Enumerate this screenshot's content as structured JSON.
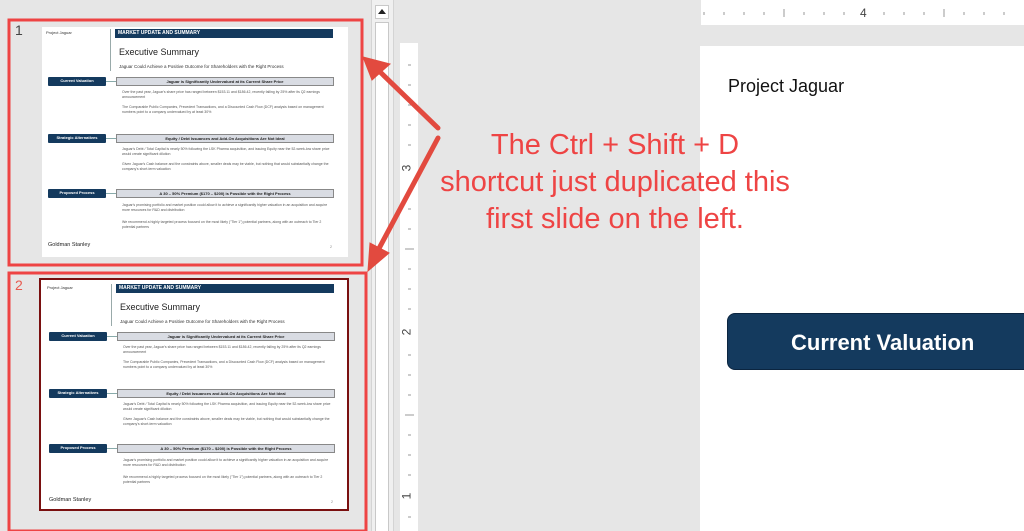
{
  "slides": [
    {
      "number": "1",
      "project": "Project Jaguar",
      "header": "MARKET UPDATE AND SUMMARY",
      "title": "Executive Summary",
      "subtitle": "Jaguar Could Achieve a Positive Outcome for Shareholders with the Right Process",
      "sections": [
        {
          "label": "Current Valuation",
          "box": "Jaguar is Significantly Undervalued at its Current Share Price",
          "bullets": [
            "Over the past year, Jaguar's share price has ranged between $153.11 and $186.42, recently falling by 25% after its Q2 earnings announcement",
            "The Comparable Public Companies, Precedent Transactions, and a Discounted Cash Flow (DCF) analysis based on management numbers point to a company undervalued by at least 30%"
          ]
        },
        {
          "label": "Strategic Alternatives",
          "box": "Equity / Debt Issuances and Add-On Acquisitions Are Not Ideal",
          "bullets": [
            "Jaguar's Debt / Total Capital is nearly 50% following the LSK Pharma acquisition, and issuing Equity near the 52-week-low share price would create significant dilution",
            "Given Jaguar's Cash balance and the constraints above, smaller deals may be viable, but nothing that would substantially change the company's short-term valuation"
          ]
        },
        {
          "label": "Proposed Process",
          "box": "A 30 – 50% Premium ($170 – $200) is Possible with the Right Process",
          "bullets": [
            "Jaguar's promising portfolio and market position could allow it to achieve a significantly higher valuation in an acquisition and acquire more resources for R&D and distribution",
            "We recommend a highly targeted process focused on the most likely (\"Tier 1\") potential partners, along with an outreach to Tier 2 potential partners"
          ]
        }
      ],
      "footer": "Goldman Stanley",
      "page": "2"
    },
    {
      "number": "2",
      "project": "Project Jaguar",
      "header": "MARKET UPDATE AND SUMMARY",
      "title": "Executive Summary",
      "subtitle": "Jaguar Could Achieve a Positive Outcome for Shareholders with the Right Process",
      "sections": [
        {
          "label": "Current Valuation",
          "box": "Jaguar is Significantly Undervalued at its Current Share Price",
          "bullets": [
            "Over the past year, Jaguar's share price has ranged between $153.11 and $186.42, recently falling by 25% after its Q2 earnings announcement",
            "The Comparable Public Companies, Precedent Transactions, and a Discounted Cash Flow (DCF) analysis based on management numbers point to a company undervalued by at least 30%"
          ]
        },
        {
          "label": "Strategic Alternatives",
          "box": "Equity / Debt Issuances and Add-On Acquisitions Are Not Ideal",
          "bullets": [
            "Jaguar's Debt / Total Capital is nearly 50% following the LSK Pharma acquisition, and issuing Equity near the 52-week-low share price would create significant dilution",
            "Given Jaguar's Cash balance and the constraints above, smaller deals may be viable, but nothing that would substantially change the company's short-term valuation"
          ]
        },
        {
          "label": "Proposed Process",
          "box": "A 30 – 50% Premium ($170 – $200) is Possible with the Right Process",
          "bullets": [
            "Jaguar's promising portfolio and market position could allow it to achieve a significantly higher valuation in an acquisition and acquire more resources for R&D and distribution",
            "We recommend a highly targeted process focused on the most likely (\"Tier 1\") potential partners, along with an outreach to Tier 2 potential partners"
          ]
        }
      ],
      "footer": "Goldman Stanley",
      "page": "2"
    }
  ],
  "main_slide": {
    "title": "Project Jaguar",
    "section_label": "Current Valuation"
  },
  "ruler": {
    "h_number": "4",
    "v_numbers": [
      "3",
      "2",
      "1"
    ]
  },
  "callout": {
    "text": "The Ctrl + Shift + D shortcut just duplicated this first slide on the left."
  },
  "colors": {
    "annotation_red": "#ee4444",
    "selected_border": "#7a1010",
    "navy": "#143a5e"
  },
  "icons": {
    "scroll_up": "up-arrow-icon"
  }
}
